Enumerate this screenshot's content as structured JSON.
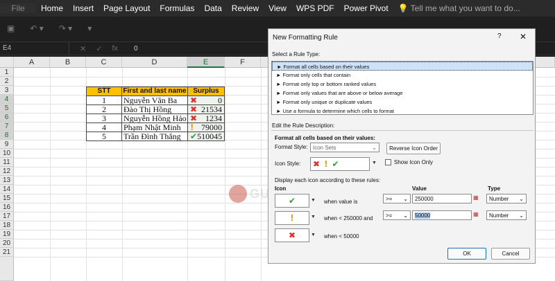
{
  "ribbon": {
    "tabs": [
      "File",
      "Home",
      "Insert",
      "Page Layout",
      "Formulas",
      "Data",
      "Review",
      "View",
      "WPS PDF",
      "Power Pivot"
    ],
    "tell_me": "Tell me what you want to do..."
  },
  "formula_bar": {
    "name_box": "E4",
    "fx": "fx",
    "value": "0"
  },
  "columns": [
    "A",
    "B",
    "C",
    "D",
    "E",
    "F"
  ],
  "rows": [
    "1",
    "2",
    "3",
    "4",
    "5",
    "6",
    "7",
    "8",
    "9",
    "10",
    "11",
    "12",
    "13",
    "14",
    "15",
    "16",
    "17",
    "18",
    "19",
    "20",
    "21"
  ],
  "table": {
    "headers": {
      "stt": "STT",
      "name": "First and last name",
      "surplus": "Surplus"
    },
    "records": [
      {
        "stt": "1",
        "name": "Nguyễn Văn Ba",
        "surplus": "0",
        "icon": "x-icon"
      },
      {
        "stt": "2",
        "name": "Đào Thị Hồng",
        "surplus": "21534",
        "icon": "x-icon"
      },
      {
        "stt": "3",
        "name": "Nguyễn Hồng Hảo",
        "surplus": "1234",
        "icon": "x-icon"
      },
      {
        "stt": "4",
        "name": "Phạm Nhật Minh",
        "surplus": "79000",
        "icon": "exclamation-icon"
      },
      {
        "stt": "5",
        "name": "Trần Đình Thắng",
        "surplus": "510045",
        "icon": "check-icon"
      }
    ]
  },
  "watermark": "GURUVN",
  "dialog": {
    "title": "New Formatting Rule",
    "help": "?",
    "close": "✕",
    "select_rule_label": "Select a Rule Type:",
    "rule_types": [
      "Format all cells based on their values",
      "Format only cells that contain",
      "Format only top or bottom ranked values",
      "Format only values that are above or below average",
      "Format only unique or duplicate values",
      "Use a formula to determine which cells to format"
    ],
    "edit_label": "Edit the Rule Description:",
    "desc_heading": "Format all cells based on their values:",
    "format_style_label": "Format Style:",
    "format_style_value": "Icon Sets",
    "reverse_button": "Reverse Icon Order",
    "icon_style_label": "Icon Style:",
    "show_icon_only": "Show Icon Only",
    "display_rules_label": "Display each icon according to these rules:",
    "col_icon": "Icon",
    "col_value": "Value",
    "col_type": "Type",
    "rules": [
      {
        "icon": "check-icon",
        "when": "when value is",
        "op": ">=",
        "value": "250000",
        "type": "Number"
      },
      {
        "icon": "exclamation-icon",
        "when": "when < 250000 and",
        "op": ">=",
        "value": "50000",
        "type": "Number"
      },
      {
        "icon": "x-icon",
        "when": "when < 50000"
      }
    ],
    "ok": "OK",
    "cancel": "Cancel"
  }
}
